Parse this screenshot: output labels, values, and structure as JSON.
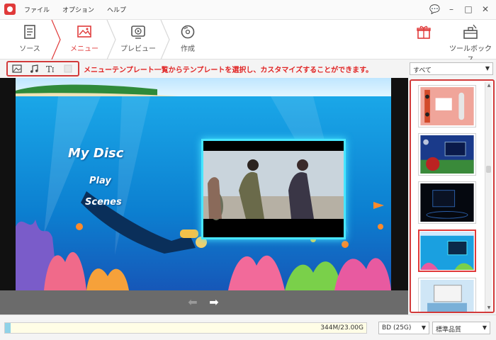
{
  "menubar": {
    "items": [
      "ファイル",
      "オプション",
      "ヘルプ"
    ]
  },
  "toolbar": {
    "steps": [
      {
        "label": "ソース",
        "icon": "source-document-icon",
        "active": false
      },
      {
        "label": "メニュー",
        "icon": "menu-image-icon",
        "active": true
      },
      {
        "label": "プレビュー",
        "icon": "preview-play-icon",
        "active": false
      },
      {
        "label": "作成",
        "icon": "burn-disc-icon",
        "active": false
      }
    ],
    "tools": [
      {
        "label": "",
        "icon": "gift-box-icon"
      },
      {
        "label": "ツールボックス",
        "icon": "toolbox-icon"
      }
    ]
  },
  "hint": {
    "text": "メニューテンプレート一覧からテンプレートを選択し、カスタマイズすることができます。"
  },
  "editor_icons": [
    "image-icon",
    "music-note-icon",
    "text-size-icon",
    "checkbox-icon"
  ],
  "preview": {
    "title": "My Disc",
    "items": [
      "Play",
      "Scenes"
    ]
  },
  "navigation": {
    "prev": "⬅",
    "next": "➡"
  },
  "templates": {
    "filter": "すべて",
    "items": [
      {
        "name": "template-pink-retro",
        "selected": false
      },
      {
        "name": "template-baseball",
        "selected": false
      },
      {
        "name": "template-dark-tech",
        "selected": false
      },
      {
        "name": "template-underwater",
        "selected": true
      },
      {
        "name": "template-family",
        "selected": false
      }
    ]
  },
  "status": {
    "capacity_text": "344M/23.00G",
    "capacity_fraction": 0.015,
    "disc_type": "BD (25G)",
    "quality": "標準品質"
  },
  "colors": {
    "accent": "#e03a3a",
    "frame_glow": "#48e6ff"
  }
}
